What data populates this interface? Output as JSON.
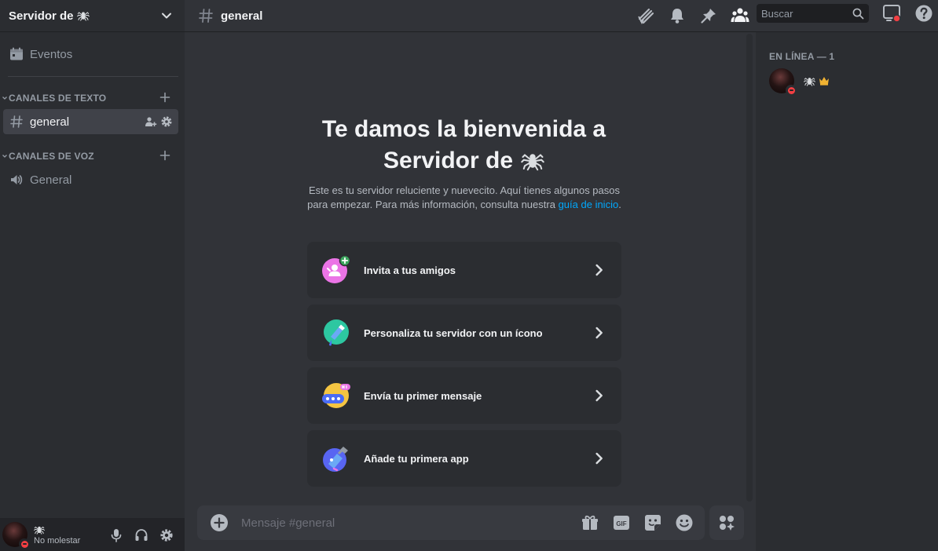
{
  "server": {
    "name": "Servidor de",
    "emoji": "spider-icon"
  },
  "sidebar": {
    "events_label": "Eventos",
    "categories": [
      {
        "label": "CANALES DE TEXTO",
        "channels": [
          {
            "name": "general",
            "type": "text",
            "active": true
          }
        ]
      },
      {
        "label": "CANALES DE VOZ",
        "channels": [
          {
            "name": "General",
            "type": "voice",
            "active": false
          }
        ]
      }
    ]
  },
  "user": {
    "name_icon": "spider-icon",
    "status": "No molestar",
    "status_color": "#f23f43"
  },
  "channel": {
    "name": "general"
  },
  "topbar": {
    "icons": [
      "threads-icon",
      "bell-icon",
      "pin-icon",
      "members-icon"
    ],
    "search_placeholder": "Buscar",
    "inbox_icon": "inbox-icon",
    "help_icon": "help-icon"
  },
  "welcome": {
    "title_line1": "Te damos la bienvenida a",
    "title_line2": "Servidor de",
    "desc_prefix": "Este es tu servidor reluciente y nuevecito. Aquí tienes algunos pasos para empezar. Para más información, consulta nuestra",
    "desc_link": "guía de inicio",
    "desc_suffix": ".",
    "cards": [
      {
        "label": "Invita a tus amigos",
        "icon": "invite-friends-icon"
      },
      {
        "label": "Personaliza tu servidor con un ícono",
        "icon": "customize-icon"
      },
      {
        "label": "Envía tu primer mensaje",
        "icon": "message-icon"
      },
      {
        "label": "Añade tu primera app",
        "icon": "app-icon"
      }
    ]
  },
  "composer": {
    "placeholder": "Mensaje #general",
    "gif_label": "GIF"
  },
  "members": {
    "heading": "EN LÍNEA — 1",
    "list": [
      {
        "name_icon": "spider-icon",
        "owner": true,
        "status": "dnd"
      }
    ]
  },
  "colors": {
    "accent_link": "#00a8fc",
    "dnd": "#f23f43",
    "crown": "#f0b232",
    "background": "#313338",
    "sidebar": "#2b2d31"
  }
}
